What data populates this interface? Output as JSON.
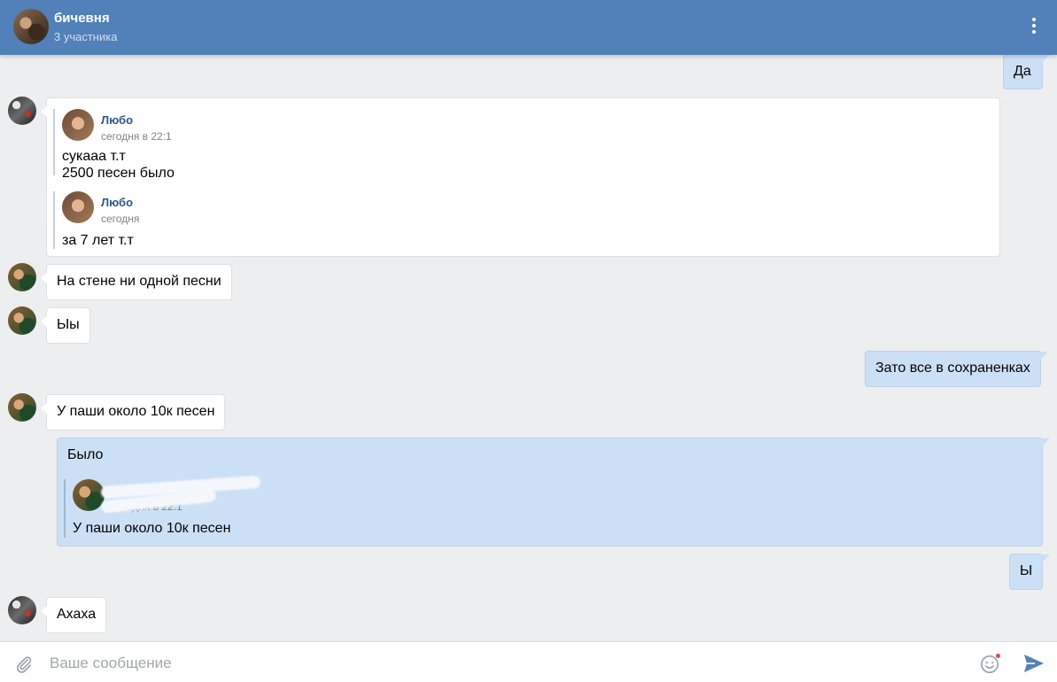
{
  "header": {
    "title": "бичевня",
    "subtitle": "3 участника",
    "more_icon": "more-vertical-icon"
  },
  "messages": [
    {
      "direction": "out",
      "text": "Да"
    },
    {
      "direction": "in",
      "quotes": [
        {
          "author": "Любо",
          "time": "сегодня в 22:1",
          "lines": [
            "сукааа т.т",
            "2500 песен было"
          ]
        },
        {
          "author": "Любо",
          "time": "сегодня",
          "lines": [
            "за 7 лет т.т"
          ]
        }
      ]
    },
    {
      "direction": "in",
      "text": "На стене ни одной песни"
    },
    {
      "direction": "in",
      "text": "Ыы"
    },
    {
      "direction": "out",
      "text": "Зато все в сохраненках"
    },
    {
      "direction": "in",
      "text": "У паши около 10к песен"
    },
    {
      "direction": "out",
      "text": "Было",
      "quote": {
        "time": "сегодня в 22:1",
        "body": "У паши около 10к песен"
      }
    },
    {
      "direction": "out",
      "text": "Ы"
    },
    {
      "direction": "in",
      "text": "Ахаха"
    }
  ],
  "composer": {
    "placeholder": "Ваше сообщение",
    "attach_icon": "paperclip-icon",
    "emoji_icon": "smile-icon",
    "send_icon": "send-icon"
  },
  "colors": {
    "header_bg": "#5181b8",
    "chat_bg": "#edeef0",
    "outgoing_bubble": "#cce0f5",
    "incoming_bubble": "#ffffff",
    "link_name": "#2a5885"
  }
}
